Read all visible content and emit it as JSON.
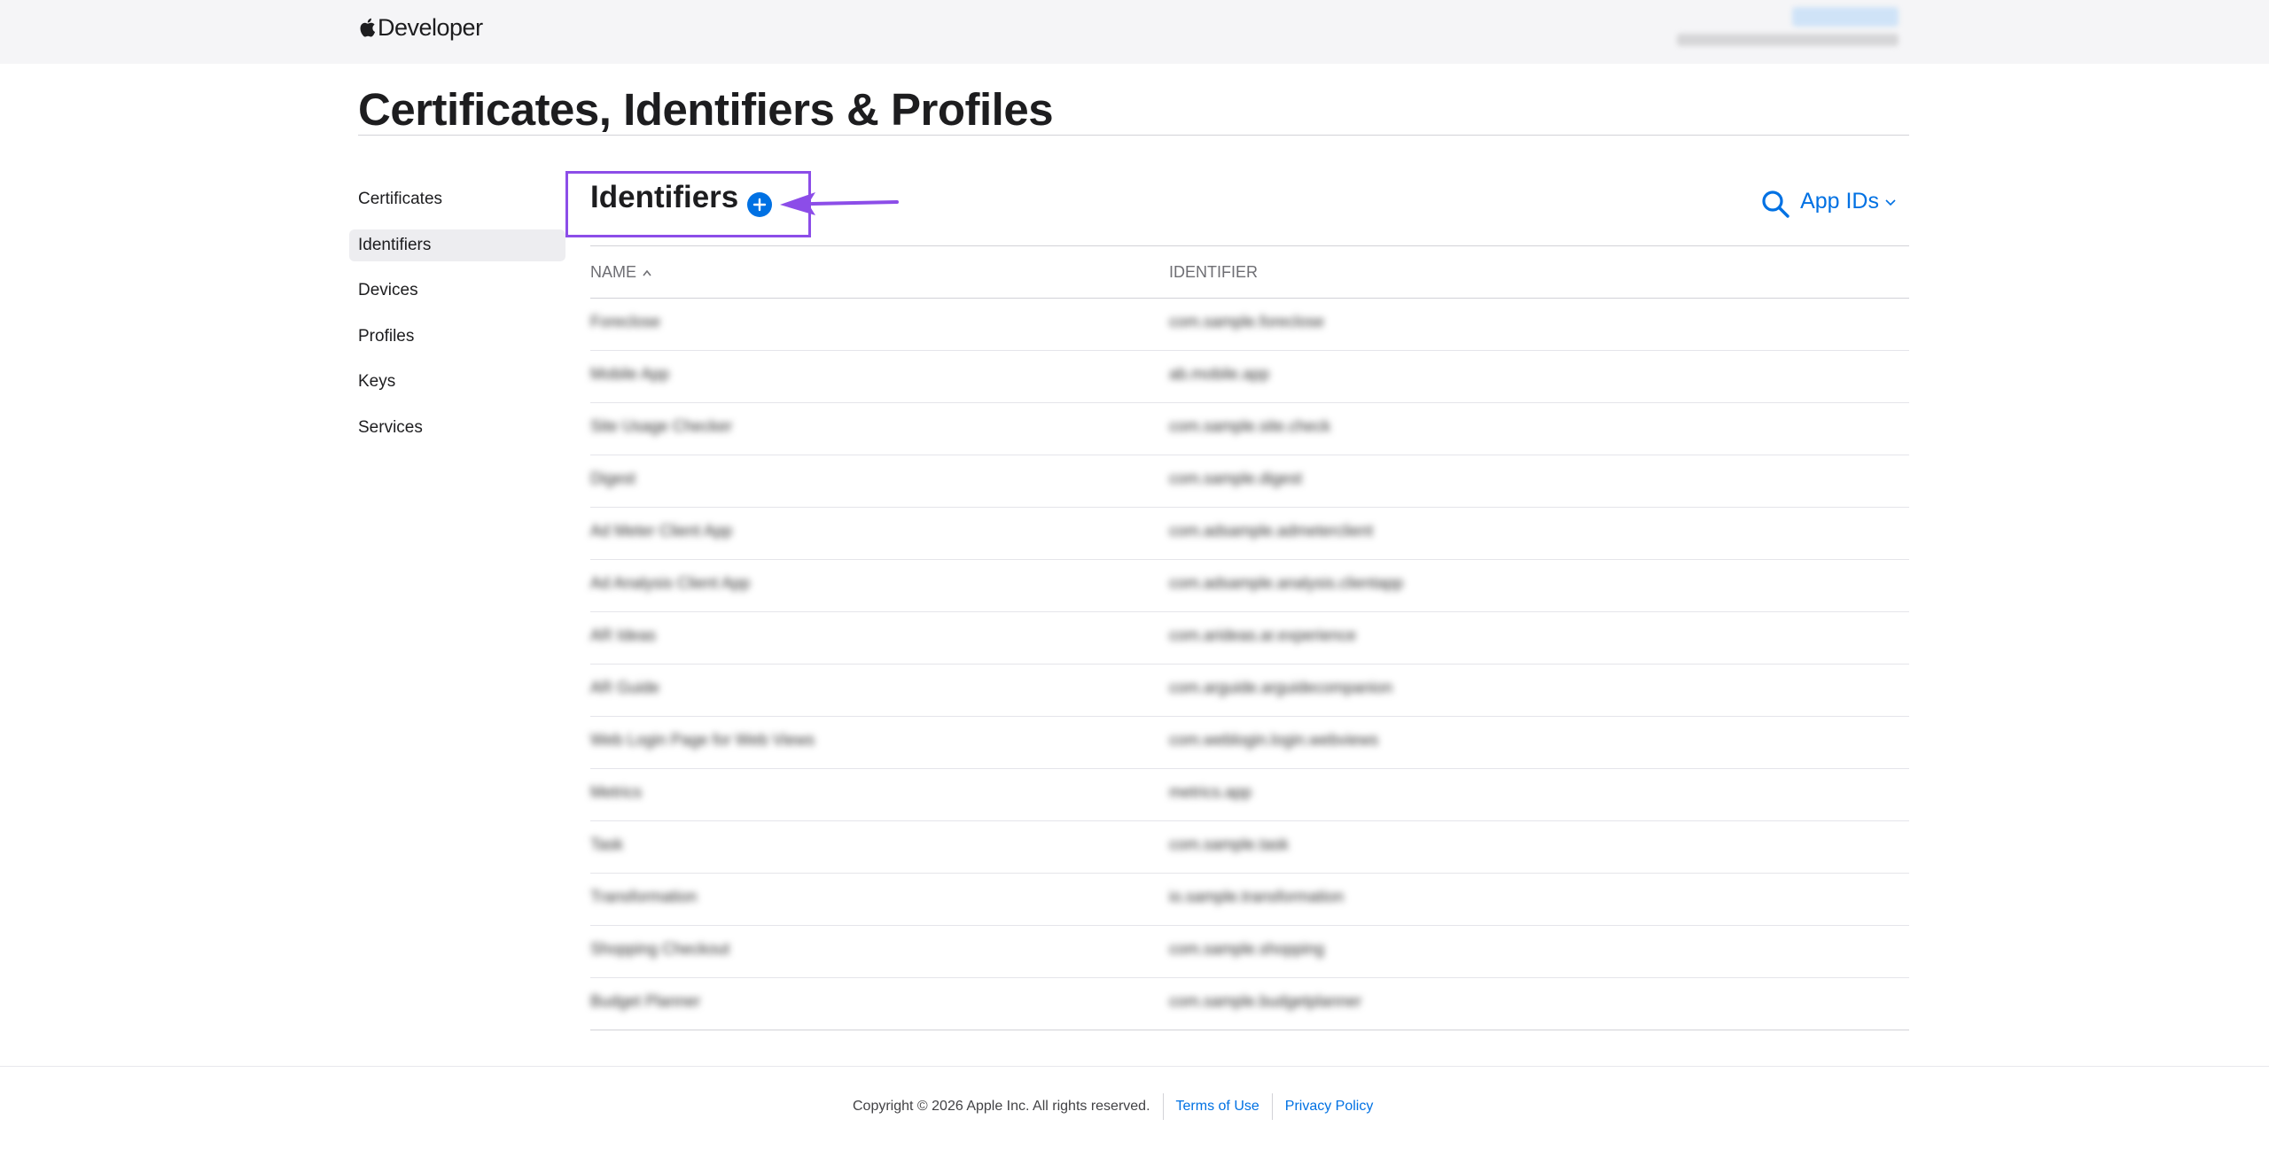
{
  "nav": {
    "logo_text": "Developer"
  },
  "page": {
    "title": "Certificates, Identifiers & Profiles"
  },
  "sidebar": {
    "items": [
      {
        "label": "Certificates"
      },
      {
        "label": "Identifiers"
      },
      {
        "label": "Devices"
      },
      {
        "label": "Profiles"
      },
      {
        "label": "Keys"
      },
      {
        "label": "Services"
      }
    ]
  },
  "content": {
    "title": "Identifiers",
    "filter_label": "App IDs",
    "columns": {
      "name": "NAME",
      "identifier": "IDENTIFIER"
    },
    "rows": [
      {
        "name": "Foreclose",
        "identifier": "com.sample.foreclose"
      },
      {
        "name": "Mobile App",
        "identifier": "ab.mobile.app"
      },
      {
        "name": "Site Usage Checker",
        "identifier": "com.sample.site.check"
      },
      {
        "name": "Digest",
        "identifier": "com.sample.digest"
      },
      {
        "name": "Ad Meter Client App",
        "identifier": "com.adsample.admeterclient"
      },
      {
        "name": "Ad Analysis Client App",
        "identifier": "com.adsample.analysis.clientapp"
      },
      {
        "name": "AR Ideas",
        "identifier": "com.arideas.ar.experience"
      },
      {
        "name": "AR Guide",
        "identifier": "com.arguide.arguidecompanion"
      },
      {
        "name": "Web Login Page for Web Views",
        "identifier": "com.weblogin.login.webviews"
      },
      {
        "name": "Metrics",
        "identifier": "metrics.app"
      },
      {
        "name": "Task",
        "identifier": "com.sample.task"
      },
      {
        "name": "Transformation",
        "identifier": "io.sample.transformation"
      },
      {
        "name": "Shopping Checkout",
        "identifier": "com.sample.shopping"
      },
      {
        "name": "Budget Planner",
        "identifier": "com.sample.budgetplanner"
      }
    ]
  },
  "footer": {
    "copyright": "Copyright © 2026 Apple Inc. All rights reserved.",
    "terms": "Terms of Use",
    "privacy": "Privacy Policy"
  },
  "colors": {
    "accent": "#0071e3",
    "highlight": "#8c4de8"
  }
}
